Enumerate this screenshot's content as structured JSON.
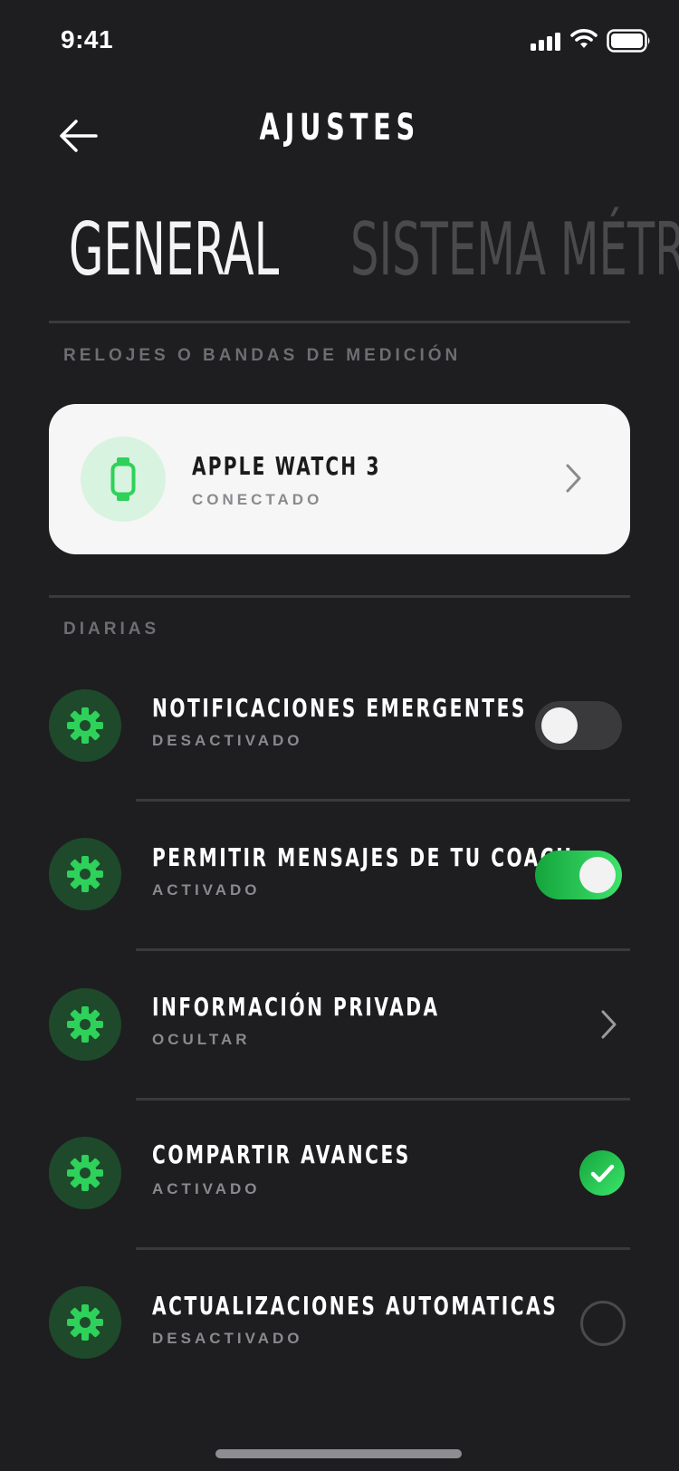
{
  "status_bar": {
    "time": "9:41"
  },
  "header": {
    "title": "AJUSTES"
  },
  "tabs": [
    {
      "label": "GENERAL",
      "active": true
    },
    {
      "label": "SISTEMA MÉTRICO",
      "active": false
    }
  ],
  "devices_section": {
    "label": "RELOJES O BANDAS DE MEDICIÓN",
    "device": {
      "name": "APPLE WATCH 3",
      "status": "CONECTADO",
      "icon": "watch-icon"
    }
  },
  "daily_section": {
    "label": "DIARIAS",
    "items": [
      {
        "title": "NOTIFICACIONES EMERGENTES",
        "subtitle": "DESACTIVADO",
        "control": "toggle",
        "state": "off",
        "icon": "gear-icon"
      },
      {
        "title": "PERMITIR MENSAJES DE TU COACH",
        "subtitle": "ACTIVADO",
        "control": "toggle",
        "state": "on",
        "icon": "gear-icon"
      },
      {
        "title": "INFORMACIÓN PRIVADA",
        "subtitle": "OCULTAR",
        "control": "chevron",
        "icon": "gear-icon"
      },
      {
        "title": "COMPARTIR AVANCES",
        "subtitle": "ACTIVADO",
        "control": "checkbox",
        "state": "checked",
        "icon": "gear-icon"
      },
      {
        "title": "ACTUALIZACIONES AUTOMATICAS",
        "subtitle": "DESACTIVADO",
        "control": "checkbox",
        "state": "unchecked",
        "icon": "gear-icon"
      }
    ]
  },
  "colors": {
    "background": "#1e1e20",
    "accent_green": "#2ed15a",
    "icon_circle": "#1e4a2b",
    "card": "#f6f6f6",
    "muted_text": "#8a8a8e"
  }
}
